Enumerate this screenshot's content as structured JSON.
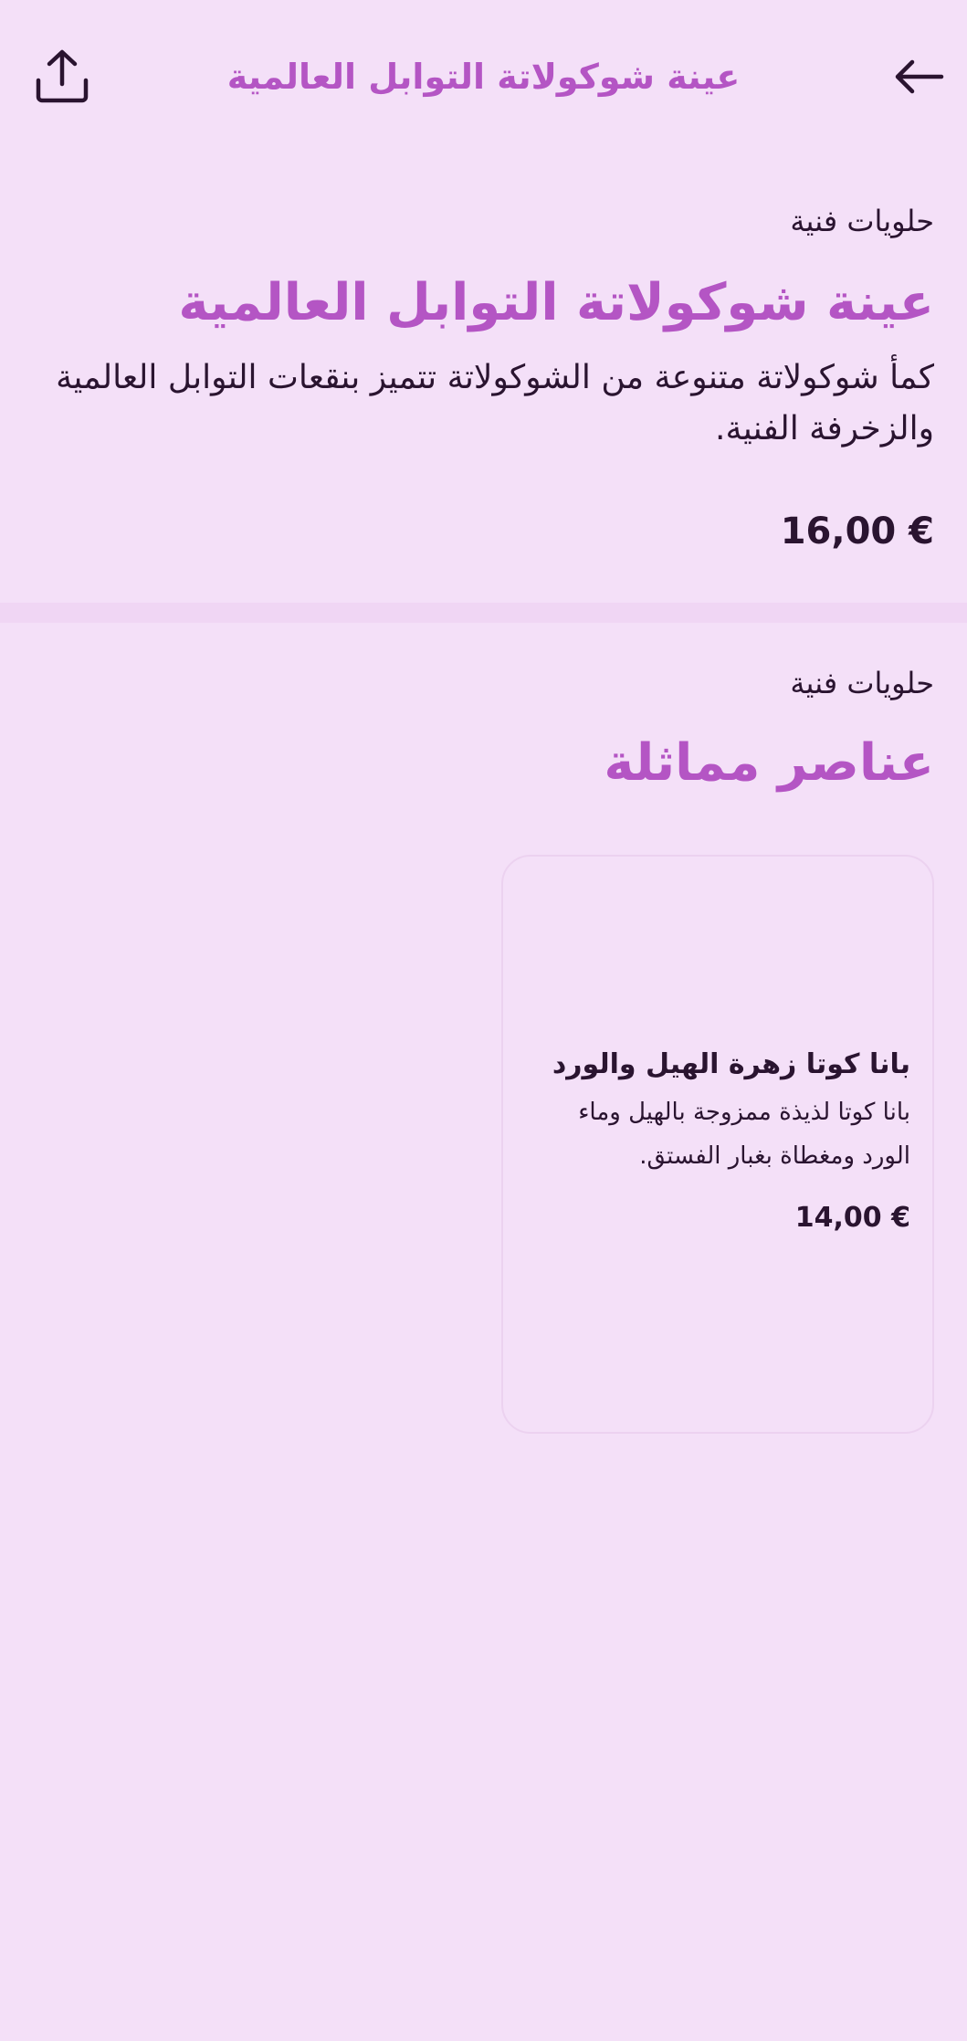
{
  "header": {
    "title": "عينة شوكولاتة التوابل العالمية",
    "back_icon": "arrow-left-icon",
    "share_icon": "share-icon"
  },
  "product": {
    "category": "حلويات فنية",
    "name": "عينة شوكولاتة التوابل العالمية",
    "description": "كمأ شوكولاتة متنوعة من الشوكولاتة تتميز بنقعات التوابل العالمية والزخرفة الفنية.",
    "price": "16,00 €"
  },
  "similar": {
    "category": "حلويات فنية",
    "title": "عناصر مماثلة",
    "items": [
      {
        "name": "بانا كوتا زهرة الهيل والورد",
        "description": "بانا كوتا لذيذة ممزوجة بالهيل وماء الورد ومغطاة بغبار الفستق.",
        "price": "14,00 €"
      }
    ]
  },
  "colors": {
    "background": "#f4e0f8",
    "accent": "#b455c4",
    "text": "#2a1430",
    "divider": "#f0d6f4"
  }
}
